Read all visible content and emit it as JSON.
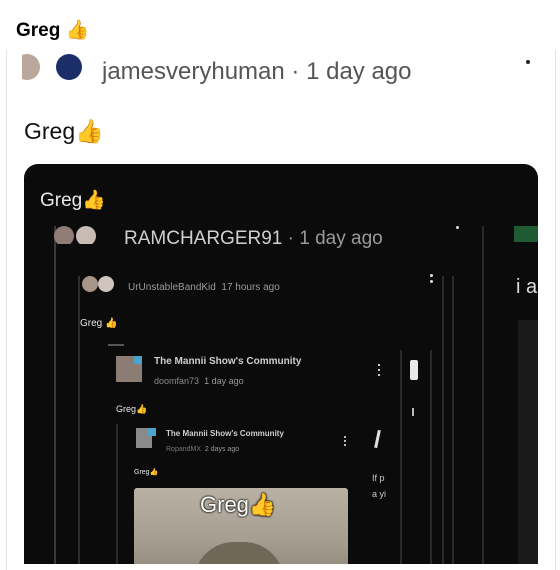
{
  "post": {
    "title": "Greg 👍"
  },
  "comment": {
    "username": "jamesveryhuman",
    "time": "· 1 day ago",
    "body": "Greg👍",
    "more_icon": "more-vertical-icon"
  },
  "video": {
    "level1": {
      "caption": "Greg👍",
      "username": "RAMCHARGER91",
      "time": "· 1 day ago",
      "side_text": "i a"
    },
    "level2": {
      "username": "UrUnstableBandKid",
      "time": "17 hours ago",
      "body": "Greg 👍"
    },
    "level3": {
      "community": "The Mannii Show's Community",
      "username": "doomfan73",
      "time": "1 day ago",
      "body": "Greg👍"
    },
    "level4": {
      "community": "The Mannii Show's Community",
      "username": "RopandMX",
      "time": "2 days ago",
      "body": "Greg👍",
      "side_text": "If p a yi"
    },
    "level5": {
      "caption": "Greg👍"
    }
  },
  "colors": {
    "background": "#ffffff",
    "video_bg": "#0b0b0b",
    "meta_text": "#555555"
  }
}
